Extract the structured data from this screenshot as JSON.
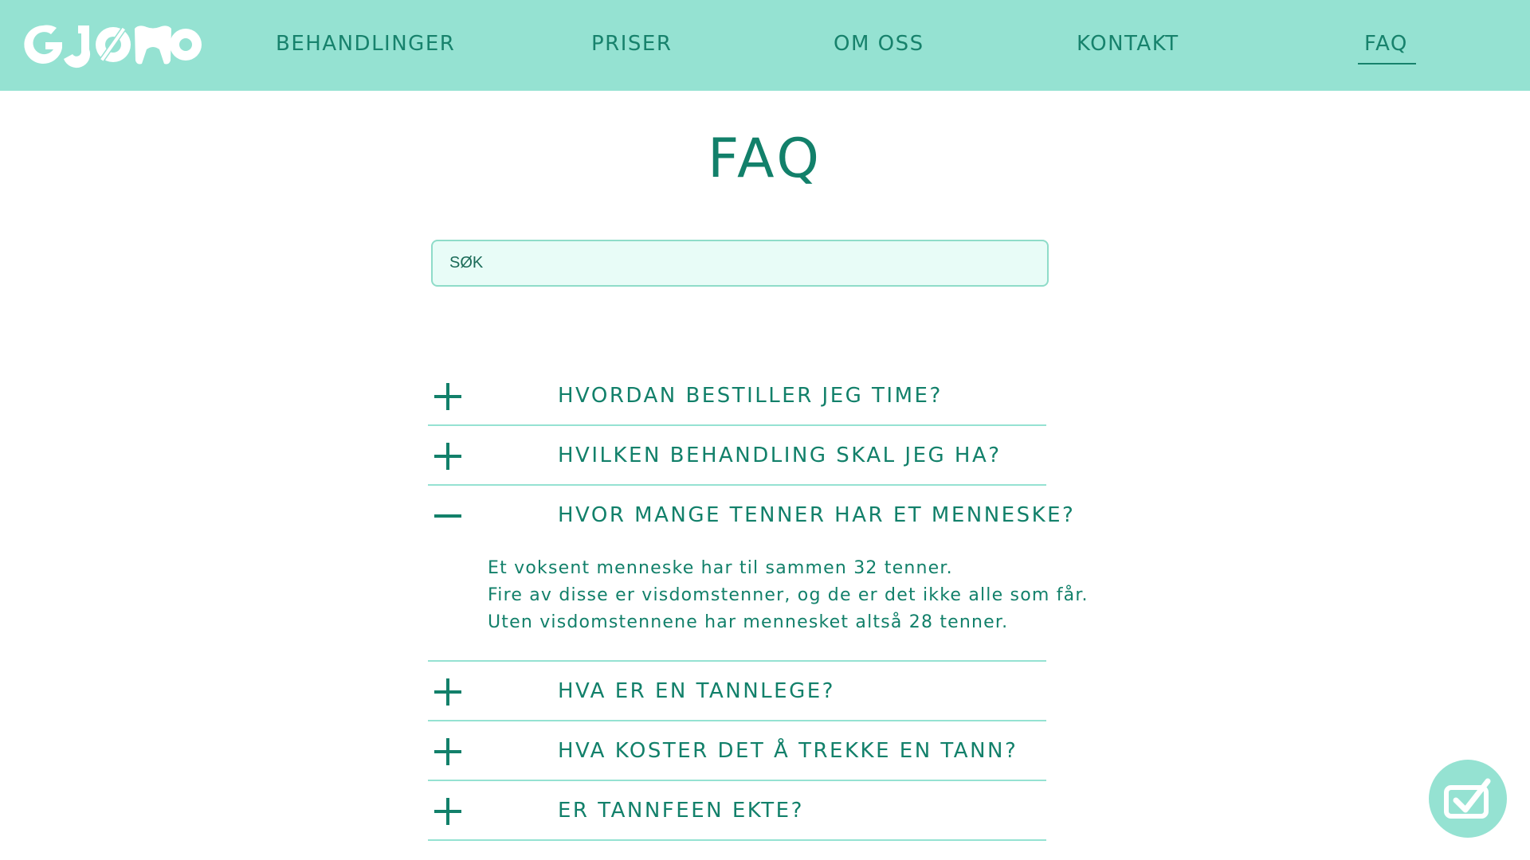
{
  "brand": {
    "logo_text": "GJØNO",
    "color_header": "#95e2d2",
    "color_text": "#12806a"
  },
  "nav": {
    "items": [
      {
        "label": "BEHANDLINGER"
      },
      {
        "label": "PRISER"
      },
      {
        "label": "OM OSS"
      },
      {
        "label": "KONTAKT"
      },
      {
        "label": "FAQ",
        "active": true
      }
    ]
  },
  "page": {
    "title": "FAQ"
  },
  "search": {
    "placeholder": "SØK",
    "value": ""
  },
  "faq": [
    {
      "question": "HVORDAN BESTILLER JEG TIME?",
      "expanded": false,
      "icon": "plus-icon"
    },
    {
      "question": "HVILKEN BEHANDLING SKAL JEG HA?",
      "expanded": false,
      "icon": "plus-icon"
    },
    {
      "question": "HVOR MANGE TENNER HAR ET MENNESKE?",
      "expanded": true,
      "icon": "minus-icon",
      "answer_lines": [
        "Et voksent menneske har til sammen 32 tenner.",
        "Fire av disse er visdomstenner, og de er det ikke alle som får.",
        "Uten visdomstennene har mennesket altså 28 tenner."
      ]
    },
    {
      "question": "HVA ER EN TANNLEGE?",
      "expanded": false,
      "icon": "plus-icon"
    },
    {
      "question": "HVA KOSTER DET Å TREKKE EN TANN?",
      "expanded": false,
      "icon": "plus-icon"
    },
    {
      "question": "ER TANNFEEN EKTE?",
      "expanded": false,
      "icon": "plus-icon"
    }
  ],
  "fab": {
    "icon": "checkbox-check-icon"
  }
}
